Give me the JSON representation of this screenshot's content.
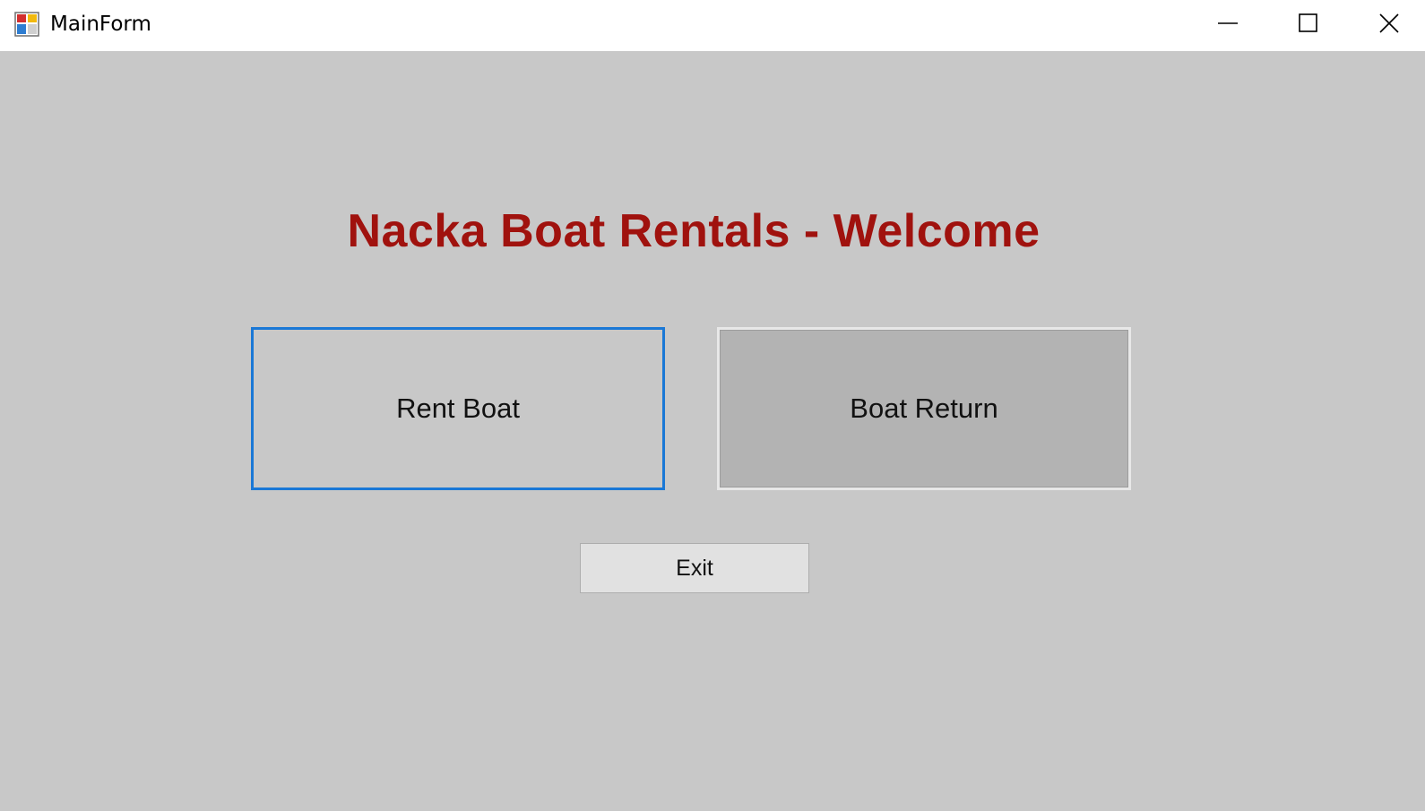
{
  "window": {
    "title": "MainForm",
    "icons": {
      "app": "app-form-icon",
      "minimize": "minimize-icon",
      "maximize": "maximize-icon",
      "close": "close-icon"
    }
  },
  "main": {
    "heading": "Nacka Boat Rentals - Welcome",
    "rent_label": "Rent Boat",
    "return_label": "Boat Return",
    "exit_label": "Exit"
  },
  "colors": {
    "heading": "#a0120e",
    "background": "#c8c8c8",
    "focus_border": "#1a78d6"
  }
}
